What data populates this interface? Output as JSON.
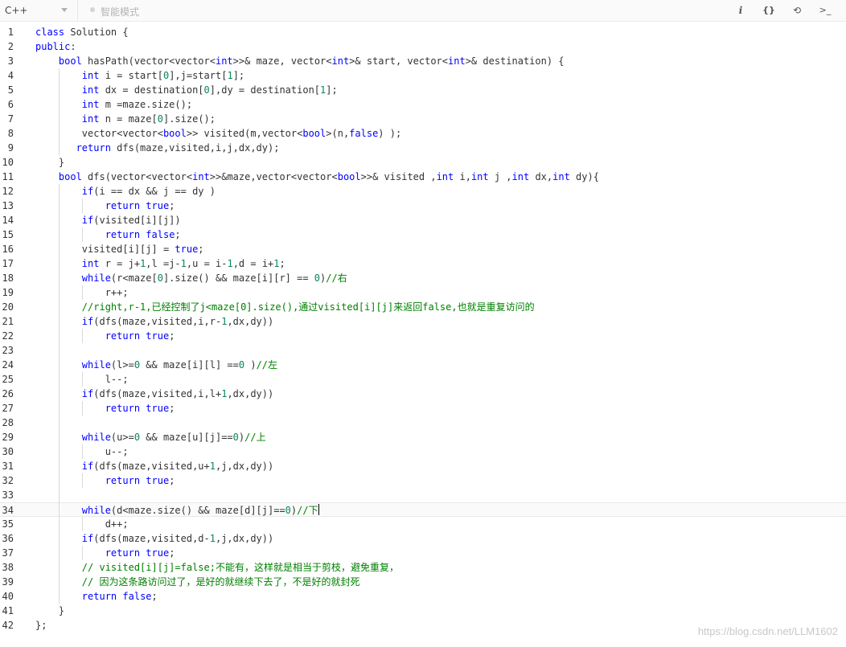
{
  "toolbar": {
    "language": "C++",
    "mode_label": "智能模式",
    "info_icon": "i",
    "format_icon": "{}",
    "reset_icon": "⟲",
    "terminal_icon": ">_"
  },
  "editor": {
    "active_line": 34,
    "lines": [
      {
        "n": "1",
        "t": "class Solution {"
      },
      {
        "n": "2",
        "t": "public:"
      },
      {
        "n": "3",
        "t": "    bool hasPath(vector<vector<int>>& maze, vector<int>& start, vector<int>& destination) {"
      },
      {
        "n": "4",
        "t": "        int i = start[0],j=start[1];"
      },
      {
        "n": "5",
        "t": "        int dx = destination[0],dy = destination[1];"
      },
      {
        "n": "6",
        "t": "        int m =maze.size();"
      },
      {
        "n": "7",
        "t": "        int n = maze[0].size();"
      },
      {
        "n": "8",
        "t": "        vector<vector<bool>> visited(m,vector<bool>(n,false) );"
      },
      {
        "n": "9",
        "t": "       return dfs(maze,visited,i,j,dx,dy);"
      },
      {
        "n": "10",
        "t": "    }"
      },
      {
        "n": "11",
        "t": "    bool dfs(vector<vector<int>>&maze,vector<vector<bool>>& visited ,int i,int j ,int dx,int dy){"
      },
      {
        "n": "12",
        "t": "        if(i == dx && j == dy )"
      },
      {
        "n": "13",
        "t": "            return true;"
      },
      {
        "n": "14",
        "t": "        if(visited[i][j])"
      },
      {
        "n": "15",
        "t": "            return false;"
      },
      {
        "n": "16",
        "t": "        visited[i][j] = true;"
      },
      {
        "n": "17",
        "t": "        int r = j+1,l =j-1,u = i-1,d = i+1;"
      },
      {
        "n": "18",
        "t": "        while(r<maze[0].size() && maze[i][r] == 0)//右"
      },
      {
        "n": "19",
        "t": "            r++;"
      },
      {
        "n": "20",
        "t": "        //right,r-1,已经控制了j<maze[0].size(),通过visited[i][j]来返回false,也就是重复访问的"
      },
      {
        "n": "21",
        "t": "        if(dfs(maze,visited,i,r-1,dx,dy))"
      },
      {
        "n": "22",
        "t": "            return true;"
      },
      {
        "n": "23",
        "t": ""
      },
      {
        "n": "24",
        "t": "        while(l>=0 && maze[i][l] ==0 )//左"
      },
      {
        "n": "25",
        "t": "            l--;"
      },
      {
        "n": "26",
        "t": "        if(dfs(maze,visited,i,l+1,dx,dy))"
      },
      {
        "n": "27",
        "t": "            return true;"
      },
      {
        "n": "28",
        "t": ""
      },
      {
        "n": "29",
        "t": "        while(u>=0 && maze[u][j]==0)//上"
      },
      {
        "n": "30",
        "t": "            u--;"
      },
      {
        "n": "31",
        "t": "        if(dfs(maze,visited,u+1,j,dx,dy))"
      },
      {
        "n": "32",
        "t": "            return true;"
      },
      {
        "n": "33",
        "t": ""
      },
      {
        "n": "34",
        "t": "        while(d<maze.size() && maze[d][j]==0)//下"
      },
      {
        "n": "35",
        "t": "            d++;"
      },
      {
        "n": "36",
        "t": "        if(dfs(maze,visited,d-1,j,dx,dy))"
      },
      {
        "n": "37",
        "t": "            return true;"
      },
      {
        "n": "38",
        "t": "        // visited[i][j]=false;不能有，这样就是相当于剪枝，避免重复，"
      },
      {
        "n": "39",
        "t": "        // 因为这条路访问过了，是好的就继续下去了，不是好的就封死"
      },
      {
        "n": "40",
        "t": "        return false;"
      },
      {
        "n": "41",
        "t": "    }"
      },
      {
        "n": "42",
        "t": "};"
      }
    ]
  },
  "watermark": "https://blog.csdn.net/LLM1602"
}
